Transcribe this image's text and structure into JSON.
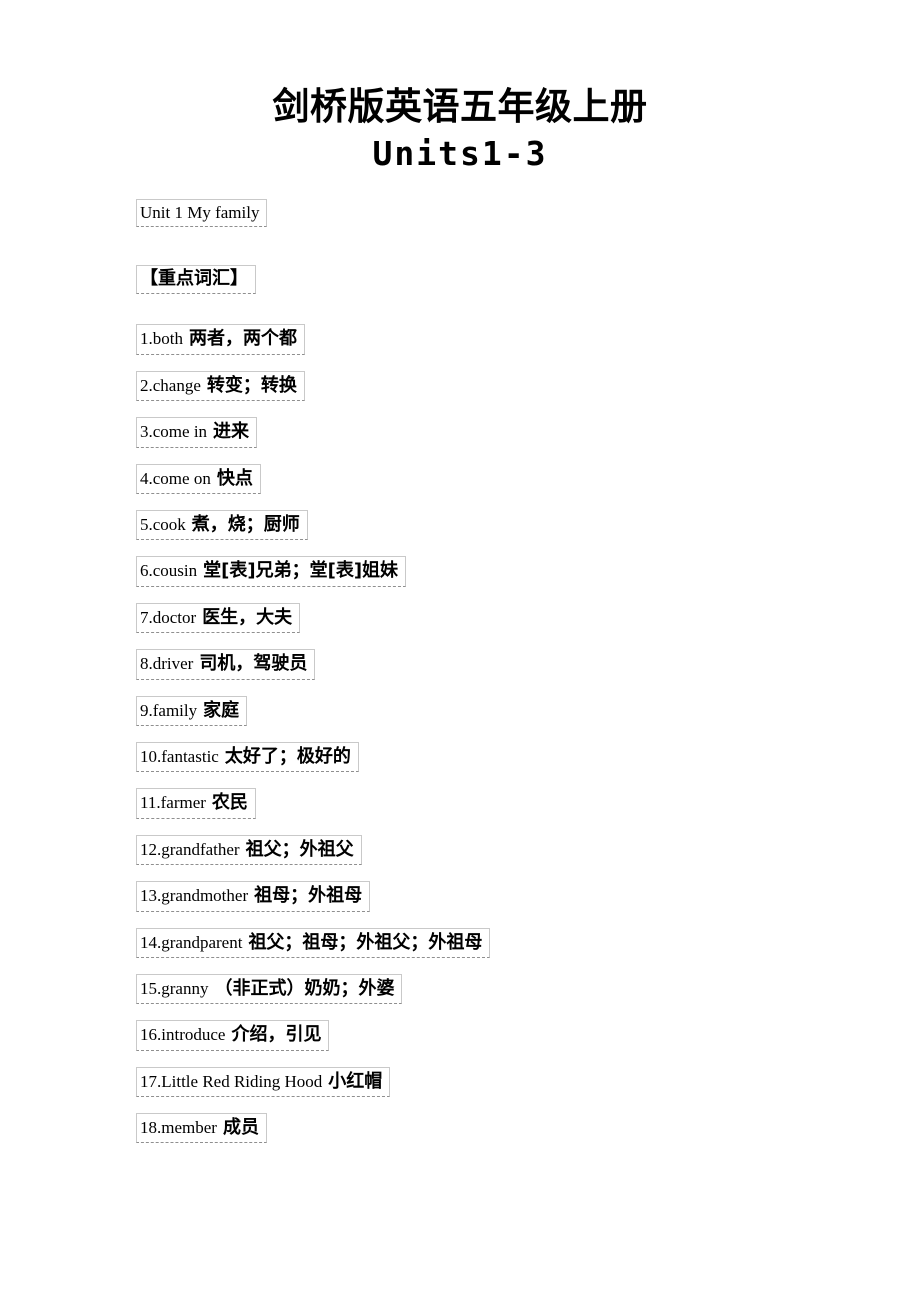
{
  "document": {
    "title_cn": "剑桥版英语五年级上册",
    "title_en": "Units1-3",
    "unit_heading": "Unit 1 My family",
    "section_label": "【重点词汇】",
    "vocabulary": [
      {
        "index": "1.",
        "en": "both",
        "cn": "两者，两个都"
      },
      {
        "index": "2.",
        "en": "change",
        "cn": "转变；转换"
      },
      {
        "index": "3.",
        "en": "come in",
        "cn": "进来"
      },
      {
        "index": "4.",
        "en": "come on",
        "cn": "快点"
      },
      {
        "index": "5.",
        "en": "cook",
        "cn": "煮，烧；厨师"
      },
      {
        "index": "6.",
        "en": "cousin",
        "cn": "堂[表]兄弟；堂[表]姐妹"
      },
      {
        "index": "7.",
        "en": "doctor",
        "cn": "医生，大夫"
      },
      {
        "index": "8.",
        "en": "driver",
        "cn": "司机，驾驶员"
      },
      {
        "index": "9.",
        "en": "family",
        "cn": "家庭"
      },
      {
        "index": "10.",
        "en": "fantastic",
        "cn": "太好了；极好的"
      },
      {
        "index": "11.",
        "en": "farmer",
        "cn": "农民"
      },
      {
        "index": "12.",
        "en": "grandfather",
        "cn": "祖父；外祖父"
      },
      {
        "index": "13.",
        "en": "grandmother",
        "cn": "祖母；外祖母"
      },
      {
        "index": "14.",
        "en": "grandparent",
        "cn": "祖父；祖母；外祖父；外祖母"
      },
      {
        "index": "15.",
        "en": "granny",
        "cn": "（非正式）奶奶；外婆"
      },
      {
        "index": "16.",
        "en": "introduce",
        "cn": "介绍，引见"
      },
      {
        "index": "17.",
        "en": "Little Red Riding Hood",
        "cn": "小红帽"
      },
      {
        "index": "18.",
        "en": "member",
        "cn": "成员"
      }
    ]
  }
}
